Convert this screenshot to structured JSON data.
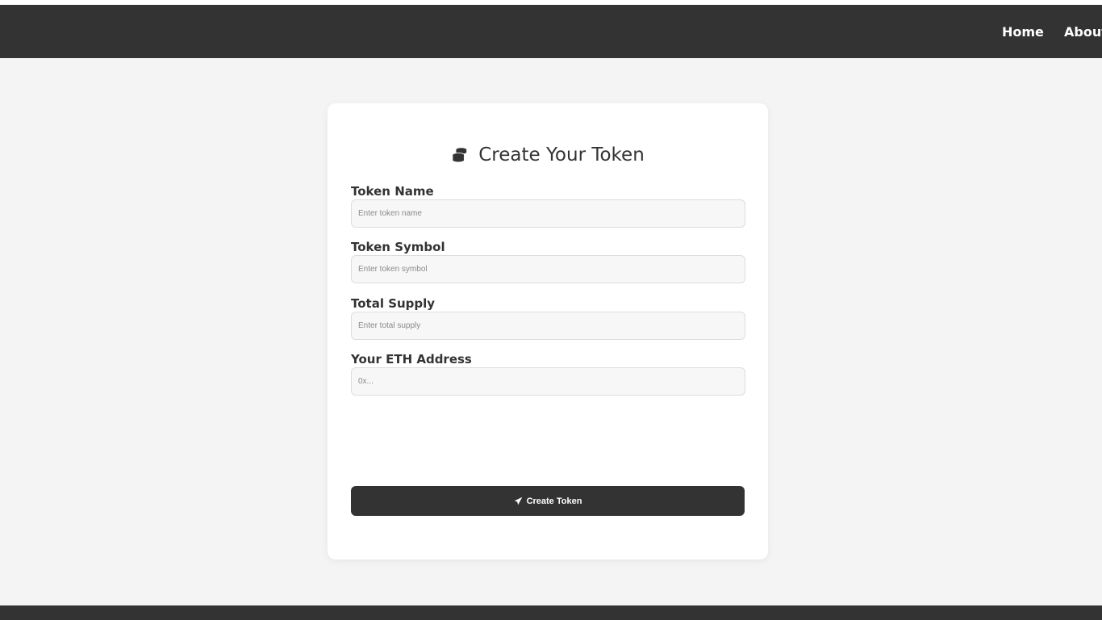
{
  "nav": {
    "links": [
      {
        "label": "Home"
      },
      {
        "label": "About"
      }
    ]
  },
  "form": {
    "icon": "coins-icon",
    "title": "Create Your Token",
    "fields": [
      {
        "label": "Token Name",
        "placeholder": "Enter token name",
        "value": ""
      },
      {
        "label": "Token Symbol",
        "placeholder": "Enter token symbol",
        "value": ""
      },
      {
        "label": "Total Supply",
        "placeholder": "Enter total supply",
        "value": ""
      },
      {
        "label": "Your ETH Address",
        "placeholder": "0x...",
        "value": ""
      }
    ],
    "submit": {
      "icon": "paper-plane-icon",
      "label": "Create Token"
    }
  },
  "colors": {
    "navbar": "#333333",
    "background": "#f4f4f4",
    "card": "#ffffff",
    "button": "#333333",
    "input_bg": "#f7f7f7",
    "input_border": "#dddddd"
  }
}
